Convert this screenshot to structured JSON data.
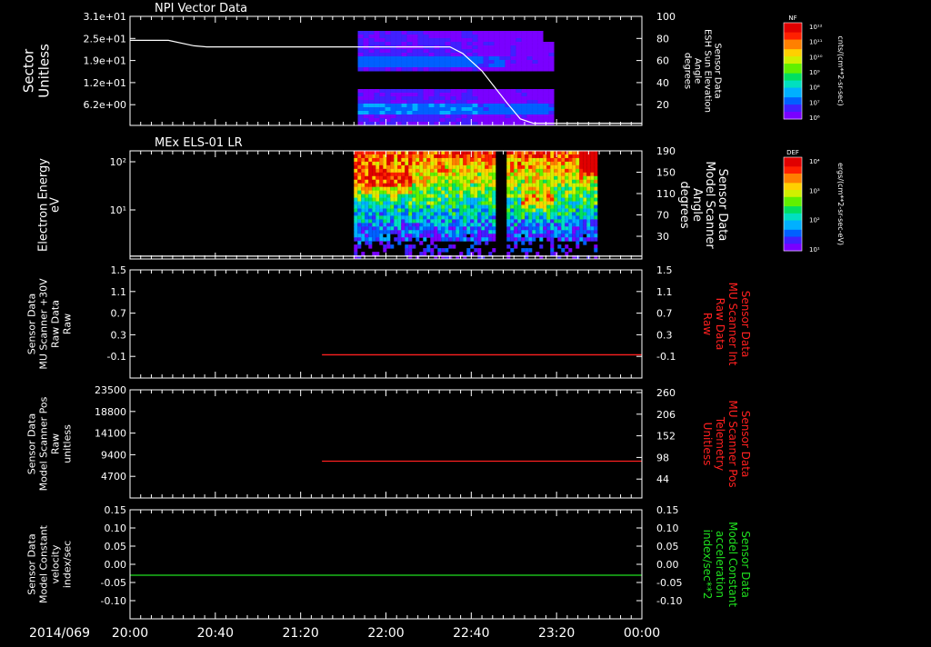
{
  "time_axis": {
    "start_label": "2014/069",
    "ticks": [
      "20:00",
      "20:40",
      "21:20",
      "22:00",
      "22:40",
      "23:20",
      "00:00"
    ],
    "range_hours": [
      20,
      24
    ]
  },
  "chart_data": [
    {
      "type": "heatmap",
      "title": "NPI Vector Data",
      "ylabel": [
        "Sector",
        "Unitless"
      ],
      "yticks": [
        "3.1e+01",
        "2.5e+01",
        "1.9e+01",
        "1.2e+01",
        "6.2e+00"
      ],
      "y2label": [
        "Sensor Data",
        "ESH Sun Elevation",
        "Angle",
        "degrees"
      ],
      "y2ticks": [
        "100",
        "80",
        "60",
        "40",
        "20"
      ],
      "y2lim": [
        0,
        100
      ],
      "colorbar": {
        "label": "NF",
        "units": "cnts/(cm**2-sr-sec)",
        "ticks": [
          "10¹²",
          "10¹¹",
          "10¹⁰",
          "10⁹",
          "10⁸",
          "10⁷",
          "10⁶"
        ]
      },
      "data_extent_hours": [
        21.78,
        23.3
      ],
      "overlay_line": {
        "axis": "y2",
        "x": [
          20.0,
          20.3,
          20.5,
          20.6,
          21.0,
          22.5,
          22.6,
          22.75,
          22.85,
          22.95,
          23.05,
          23.15,
          24.0
        ],
        "y": [
          78,
          78,
          73,
          72,
          72,
          72,
          66,
          50,
          35,
          20,
          6,
          2,
          2
        ]
      }
    },
    {
      "type": "heatmap",
      "title": "MEx ELS-01 LR",
      "ylabel": [
        "Electron Energy",
        "eV"
      ],
      "yticks": [
        "10²",
        "10¹"
      ],
      "y2label": [
        "Sensor Data",
        "Model Scanner",
        "Angle",
        "degrees"
      ],
      "y2ticks": [
        "190",
        "150",
        "110",
        "70",
        "30"
      ],
      "y2lim": [
        0,
        190
      ],
      "colorbar": {
        "label": "DEF",
        "units": "ergs/(cm**2-sr-sec-eV)",
        "ticks": [
          "10⁴",
          "10³",
          "10²",
          "10¹"
        ]
      },
      "data_extent_hours": [
        21.75,
        23.65
      ],
      "overlay_line": {
        "axis": "y2",
        "x": [
          20.0,
          24.0
        ],
        "y": [
          5,
          5
        ]
      }
    },
    {
      "type": "line",
      "ylabel": [
        "Sensor Data",
        "MU Scanner +30V",
        "Raw Data",
        "Raw"
      ],
      "yticks": [
        "1.5",
        "1.1",
        "0.7",
        "0.3",
        "-0.1"
      ],
      "ylim": [
        -0.5,
        1.5
      ],
      "y2label": [
        "Sensor Data",
        "MU Scanner Int",
        "Raw Data",
        "Raw"
      ],
      "y2ticks": [
        "1.5",
        "1.1",
        "0.7",
        "0.3",
        "-0.1"
      ],
      "y2label_color": "#ff2020",
      "series": [
        {
          "color": "#ff2020",
          "x": [
            21.5,
            24.0
          ],
          "y": [
            -0.07,
            -0.07
          ]
        }
      ]
    },
    {
      "type": "line",
      "ylabel": [
        "Sensor Data",
        "Model Scanner Pos",
        "Raw",
        "unitless"
      ],
      "yticks": [
        "23500",
        "18800",
        "14100",
        "9400",
        "4700"
      ],
      "ylim": [
        0,
        23500
      ],
      "y2label": [
        "Sensor Data",
        "MU Scanner Pos",
        "Telemetry",
        "Unitless"
      ],
      "y2ticks": [
        "260",
        "206",
        "152",
        "98",
        "44"
      ],
      "y2label_color": "#ff2020",
      "series": [
        {
          "color": "#ff2020",
          "x": [
            21.5,
            24.0
          ],
          "y": [
            8000,
            8000
          ]
        }
      ]
    },
    {
      "type": "line",
      "ylabel": [
        "Sensor Data",
        "Model Constant",
        "velocity",
        "index/sec"
      ],
      "yticks": [
        "0.15",
        "0.10",
        "0.05",
        "0.00",
        "-0.05",
        "-0.10"
      ],
      "ylim": [
        -0.1,
        0.15
      ],
      "y2label": [
        "Sensor Data",
        "Model Constant",
        "acceleration",
        "index/sec**2"
      ],
      "y2ticks": [
        "0.15",
        "0.10",
        "0.05",
        "0.00",
        "-0.05",
        "-0.10"
      ],
      "y2label_color": "#20e020",
      "series": [
        {
          "color": "#20e020",
          "x": [
            20.0,
            24.0
          ],
          "y": [
            0.0,
            0.0
          ]
        }
      ]
    }
  ]
}
